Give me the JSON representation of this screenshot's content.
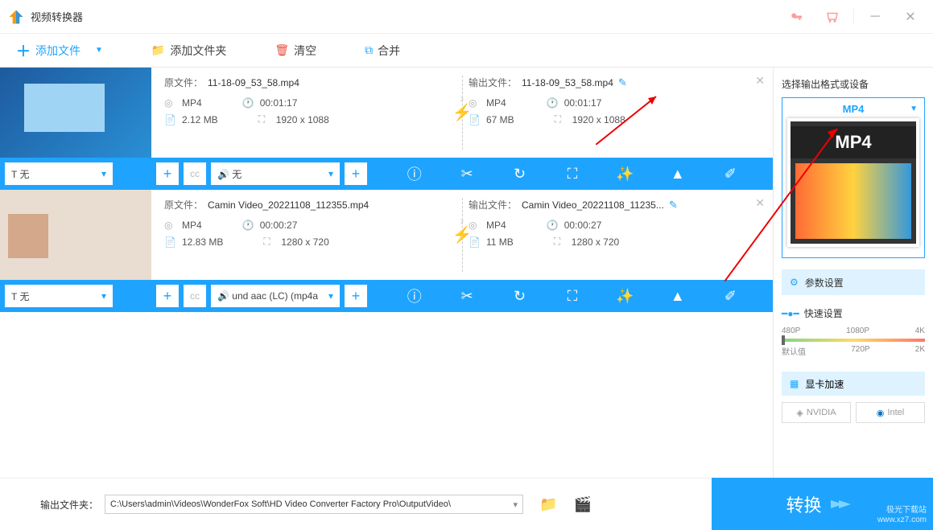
{
  "app": {
    "title": "视频转换器"
  },
  "toolbar": {
    "add_file": "添加文件",
    "add_folder": "添加文件夹",
    "clear": "清空",
    "merge": "合并"
  },
  "files": [
    {
      "source_label": "原文件：",
      "source_name": "11-18-09_53_58.mp4",
      "output_label": "输出文件：",
      "output_name": "11-18-09_53_58.mp4",
      "src_format": "MP4",
      "src_duration": "00:01:17",
      "src_size": "2.12 MB",
      "src_resolution": "1920 x 1088",
      "out_format": "MP4",
      "out_duration": "00:01:17",
      "out_size": "67 MB",
      "out_resolution": "1920 x 1088",
      "subtitle": "无",
      "audio": "无"
    },
    {
      "source_label": "原文件：",
      "source_name": "Camin Video_20221108_112355.mp4",
      "output_label": "输出文件：",
      "output_name": "Camin Video_20221108_11235...",
      "src_format": "MP4",
      "src_duration": "00:00:27",
      "src_size": "12.83 MB",
      "src_resolution": "1280 x 720",
      "out_format": "MP4",
      "out_duration": "00:00:27",
      "out_size": "11 MB",
      "out_resolution": "1280 x 720",
      "subtitle": "无",
      "audio": "und aac (LC) (mp4a"
    }
  ],
  "sidebar": {
    "select_format": "选择输出格式或设备",
    "format": "MP4",
    "params": "参数设置",
    "quick": "快速设置",
    "res_labels": [
      "480P",
      "1080P",
      "4K"
    ],
    "res_labels2": [
      "默认值",
      "720P",
      "2K"
    ],
    "gpu": "显卡加速",
    "nvidia": "NVIDIA",
    "intel": "Intel"
  },
  "footer": {
    "out_label": "输出文件夹：",
    "out_path": "C:\\Users\\admin\\Videos\\WonderFox Soft\\HD Video Converter Factory Pro\\OutputVideo\\",
    "convert": "转换"
  },
  "watermark": {
    "l1": "极光下载站",
    "l2": "www.xz7.com"
  }
}
